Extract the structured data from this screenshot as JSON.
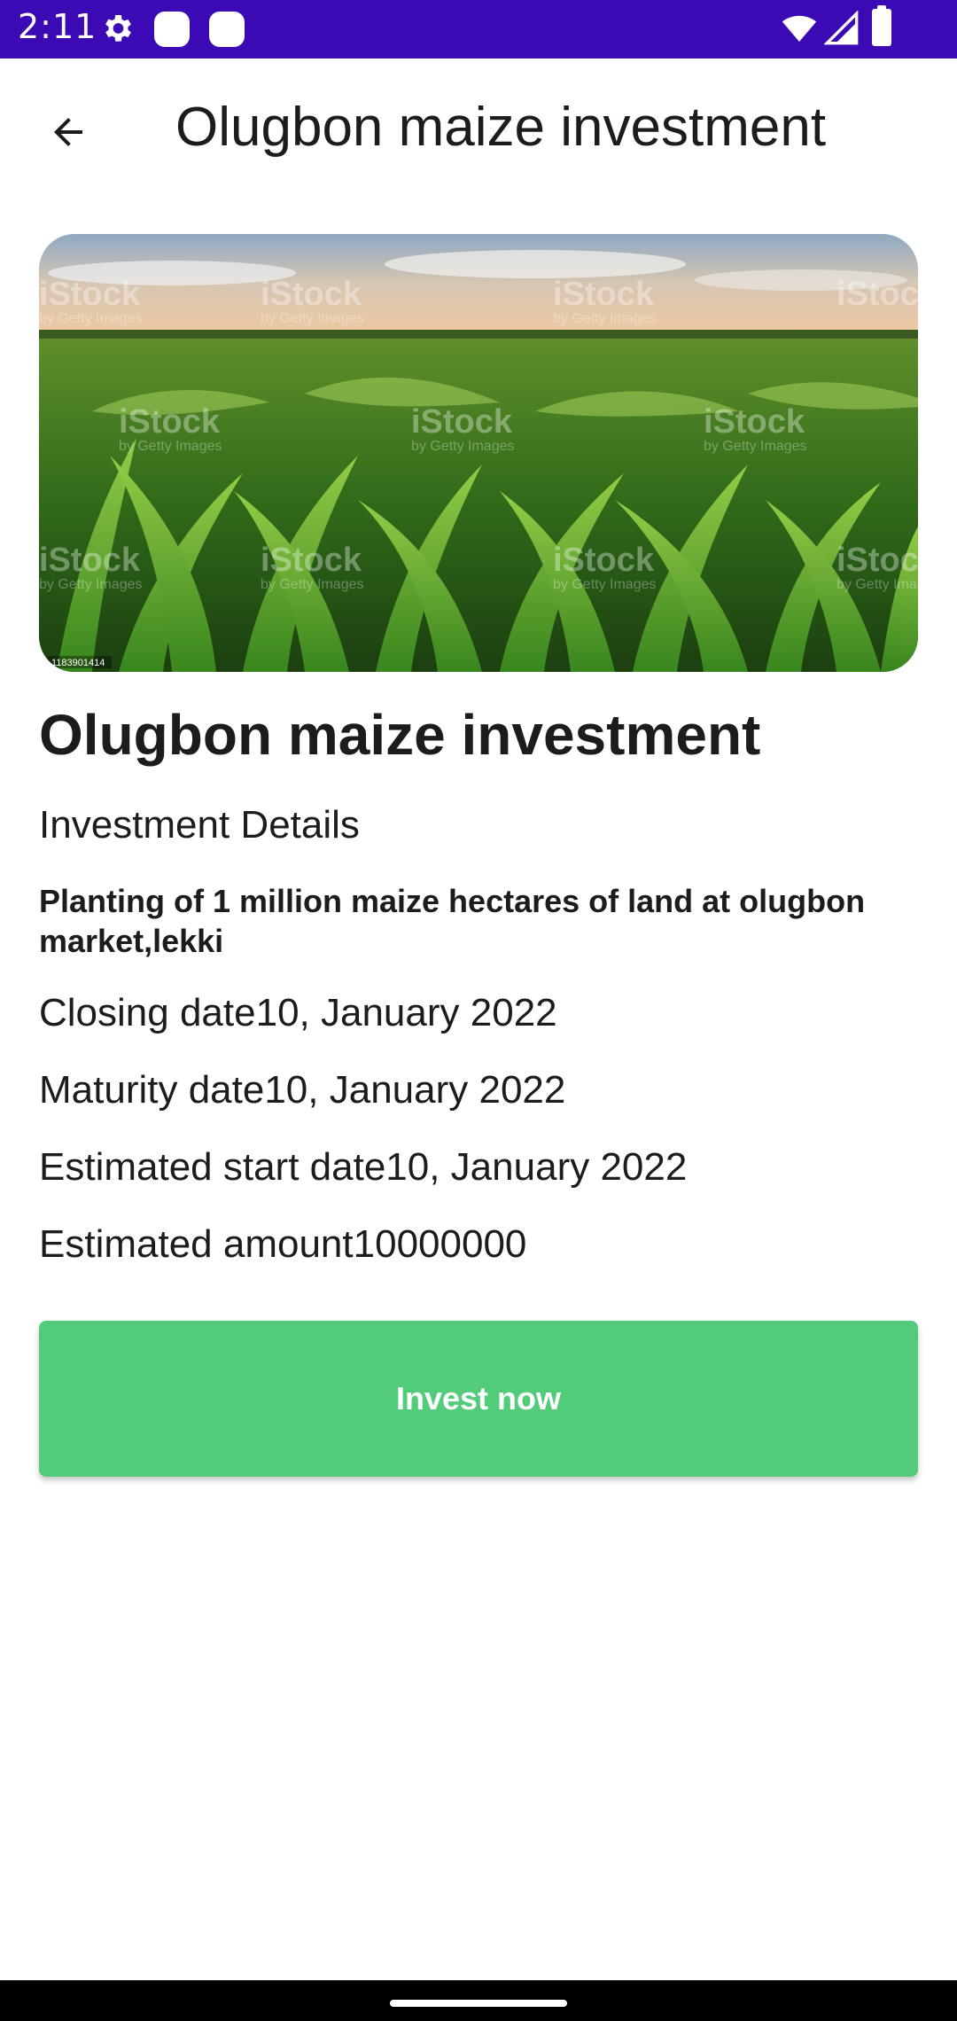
{
  "status_bar": {
    "time": "2:11",
    "icons": [
      "gear-icon",
      "notification-dot-icon",
      "notification-dot-icon",
      "wifi-icon",
      "signal-icon",
      "battery-icon"
    ],
    "background": "#3c0ab4"
  },
  "app_bar": {
    "back_icon": "arrow-back-icon",
    "title": "Olugbon maize investment"
  },
  "hero": {
    "watermark": "iStock",
    "watermark_sub": "by Getty Images",
    "image_id": "1183901414"
  },
  "content": {
    "title": "Olugbon maize investment",
    "section_label": "Investment Details",
    "description": "Planting of 1 million maize hectares of land at olugbon market,lekki",
    "closing_date": "Closing date10, January 2022",
    "maturity_date": "Maturity date10, January 2022",
    "estimated_start_date": "Estimated start date10, January 2022",
    "estimated_amount": "Estimated amount10000000"
  },
  "actions": {
    "invest_label": "Invest now",
    "invest_color": "#52cb7b"
  }
}
